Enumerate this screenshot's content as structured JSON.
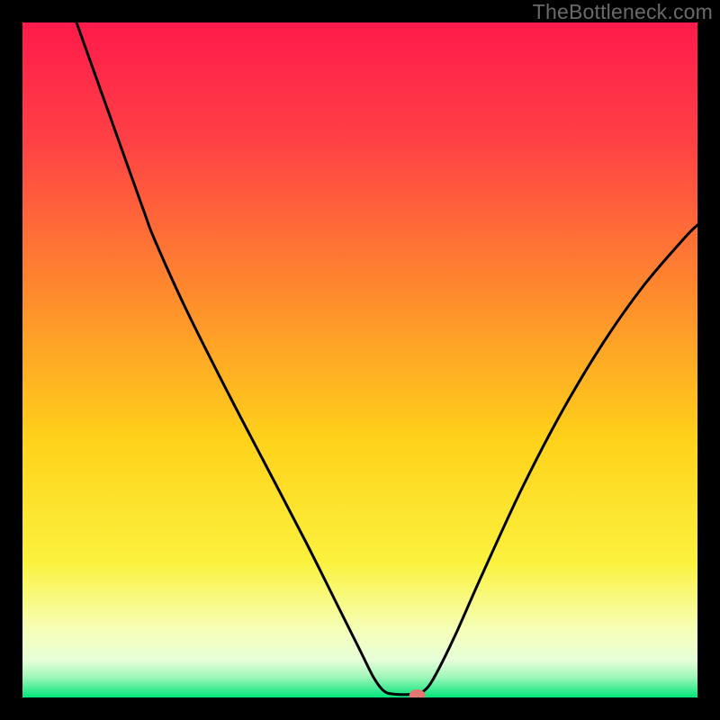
{
  "watermark": "TheBottleneck.com",
  "chart_data": {
    "type": "line",
    "title": "",
    "xlabel": "",
    "ylabel": "",
    "xlim": [
      0,
      100
    ],
    "ylim": [
      0,
      100
    ],
    "gradient_stops": [
      {
        "offset": 0.0,
        "color": "#ff1a4b"
      },
      {
        "offset": 0.18,
        "color": "#ff4245"
      },
      {
        "offset": 0.4,
        "color": "#ff8a2d"
      },
      {
        "offset": 0.62,
        "color": "#ffd21a"
      },
      {
        "offset": 0.8,
        "color": "#fbf23e"
      },
      {
        "offset": 0.9,
        "color": "#f6ffb9"
      },
      {
        "offset": 0.945,
        "color": "#e6ffd9"
      },
      {
        "offset": 0.97,
        "color": "#9ef6b8"
      },
      {
        "offset": 1.0,
        "color": "#00e57a"
      }
    ],
    "series": [
      {
        "name": "bottleneck-curve",
        "points": [
          {
            "x": 8.0,
            "y": 100.0
          },
          {
            "x": 13.0,
            "y": 86.0
          },
          {
            "x": 18.0,
            "y": 72.0
          },
          {
            "x": 19.5,
            "y": 68.0
          },
          {
            "x": 24.0,
            "y": 58.0
          },
          {
            "x": 30.0,
            "y": 46.0
          },
          {
            "x": 36.0,
            "y": 34.5
          },
          {
            "x": 42.0,
            "y": 23.0
          },
          {
            "x": 47.0,
            "y": 13.0
          },
          {
            "x": 50.0,
            "y": 7.0
          },
          {
            "x": 52.0,
            "y": 3.0
          },
          {
            "x": 53.5,
            "y": 1.0
          },
          {
            "x": 55.0,
            "y": 0.5
          },
          {
            "x": 58.0,
            "y": 0.5
          },
          {
            "x": 59.5,
            "y": 1.0
          },
          {
            "x": 61.0,
            "y": 3.0
          },
          {
            "x": 64.0,
            "y": 9.0
          },
          {
            "x": 68.0,
            "y": 18.0
          },
          {
            "x": 74.0,
            "y": 31.0
          },
          {
            "x": 80.0,
            "y": 42.5
          },
          {
            "x": 86.0,
            "y": 52.5
          },
          {
            "x": 92.0,
            "y": 61.0
          },
          {
            "x": 98.0,
            "y": 68.0
          },
          {
            "x": 100.0,
            "y": 70.0
          }
        ]
      }
    ],
    "marker": {
      "x": 58.5,
      "y": 0.3,
      "rx": 1.2,
      "ry": 0.9
    }
  }
}
